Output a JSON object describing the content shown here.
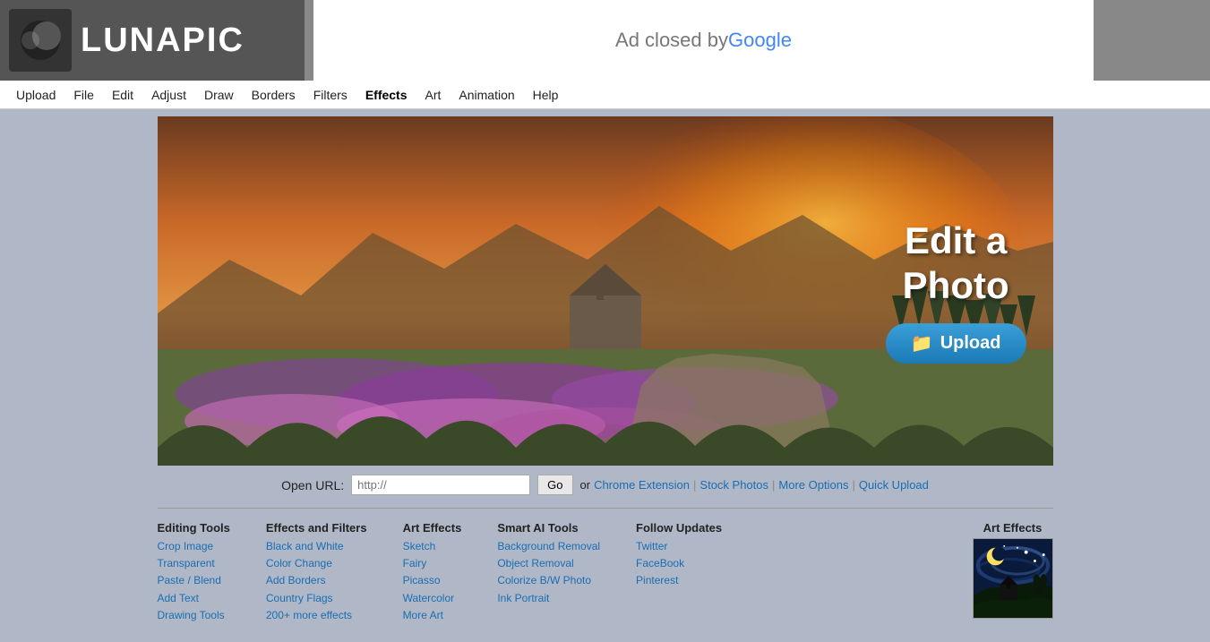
{
  "header": {
    "logo_text": "LUNAPIC",
    "ad_closed_text": "Ad closed by ",
    "ad_google": "Google"
  },
  "navbar": {
    "items": [
      {
        "label": "Upload",
        "id": "upload"
      },
      {
        "label": "File",
        "id": "file"
      },
      {
        "label": "Edit",
        "id": "edit"
      },
      {
        "label": "Adjust",
        "id": "adjust"
      },
      {
        "label": "Draw",
        "id": "draw"
      },
      {
        "label": "Borders",
        "id": "borders"
      },
      {
        "label": "Filters",
        "id": "filters"
      },
      {
        "label": "Effects",
        "id": "effects"
      },
      {
        "label": "Art",
        "id": "art"
      },
      {
        "label": "Animation",
        "id": "animation"
      },
      {
        "label": "Help",
        "id": "help"
      }
    ]
  },
  "hero": {
    "title_line1": "Edit a",
    "title_line2": "Photo",
    "upload_button": "Upload",
    "upload_icon": "📁"
  },
  "url_bar": {
    "label": "Open URL:",
    "placeholder": "http://",
    "go_button": "Go",
    "or_text": "or",
    "chrome_extension": "Chrome Extension",
    "separator1": "|",
    "stock_photos": "Stock Photos",
    "separator2": "|",
    "more_options": "More Options",
    "separator3": "|",
    "quick_upload": "Quick Upload"
  },
  "footer": {
    "editing_tools": {
      "heading": "Editing Tools",
      "links": [
        "Crop Image",
        "Transparent",
        "Paste / Blend",
        "Add Text",
        "Drawing Tools"
      ]
    },
    "effects_filters": {
      "heading": "Effects and Filters",
      "links": [
        "Black and White",
        "Color Change",
        "Add Borders",
        "Country Flags",
        "200+ more effects"
      ]
    },
    "art_effects": {
      "heading": "Art Effects",
      "links": [
        "Sketch",
        "Fairy",
        "Picasso",
        "Watercolor",
        "More Art"
      ]
    },
    "smart_ai": {
      "heading": "Smart AI Tools",
      "links": [
        "Background Removal",
        "Object Removal",
        "Colorize B/W Photo",
        "Ink Portrait"
      ]
    },
    "follow": {
      "heading": "Follow Updates",
      "links": [
        "Twitter",
        "FaceBook",
        "Pinterest"
      ]
    },
    "art_thumb": {
      "heading": "Art Effects"
    }
  }
}
